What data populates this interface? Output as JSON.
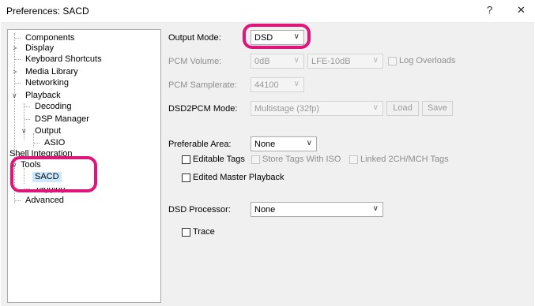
{
  "window": {
    "title": "Preferences: SACD",
    "help_label": "?",
    "close_label": "✕",
    "accent": "#e0157a",
    "selection": "#cce8ff"
  },
  "tree": {
    "components": "Components",
    "display": "Display",
    "keyboard": "Keyboard Shortcuts",
    "media_library": "Media Library",
    "networking": "Networking",
    "playback": "Playback",
    "decoding": "Decoding",
    "dsp_manager": "DSP Manager",
    "output": "Output",
    "asio": "ASIO",
    "shell": "Shell Integration",
    "tools": "Tools",
    "sacd": "SACD",
    "tagging": "Tagging",
    "advanced": "Advanced",
    "expanded_glyph": "∨",
    "collapsed_glyph": ">"
  },
  "settings": {
    "output_mode": {
      "label": "Output Mode:",
      "value": "DSD"
    },
    "pcm_volume": {
      "label": "PCM Volume:",
      "value": "0dB",
      "lfe_value": "LFE-10dB",
      "log_overloads": "Log Overloads"
    },
    "pcm_samplerate": {
      "label": "PCM Samplerate:",
      "value": "44100"
    },
    "dsd2pcm": {
      "label": "DSD2PCM Mode:",
      "value": "Multistage (32fp)",
      "load": "Load",
      "save": "Save"
    },
    "preferable_area": {
      "label": "Preferable Area:",
      "value": "None"
    },
    "editable_tags": "Editable Tags",
    "store_tags_iso": "Store Tags With ISO",
    "linked_tags": "Linked 2CH/MCH Tags",
    "edited_master": "Edited Master Playback",
    "dsd_processor": {
      "label": "DSD Processor:",
      "value": "None"
    },
    "trace": "Trace"
  }
}
